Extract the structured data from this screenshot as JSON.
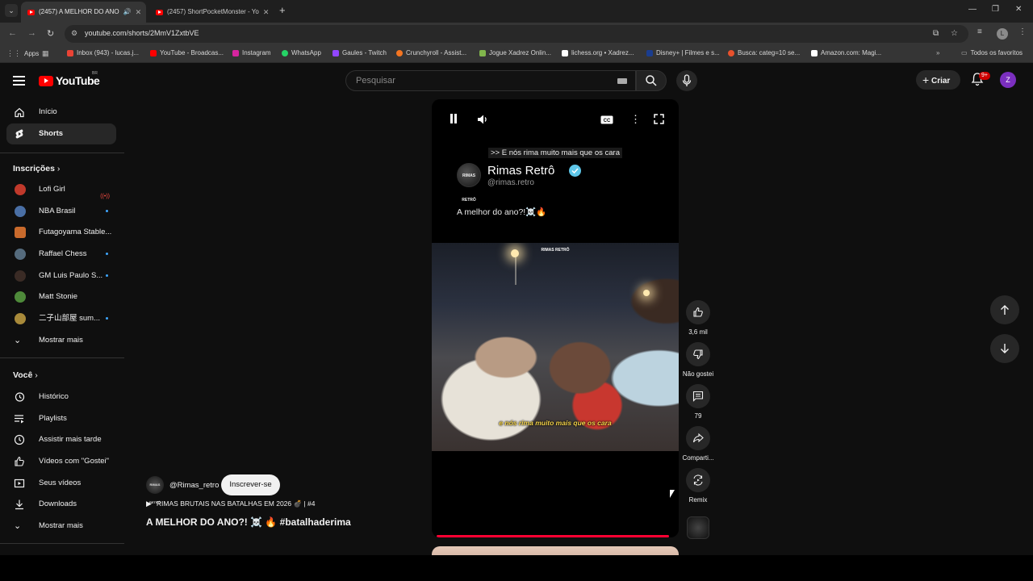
{
  "browser": {
    "tabs": [
      {
        "title": "(2457) A MELHOR DO ANO",
        "active": true
      },
      {
        "title": "(2457) ShortPocketMonster - Yo",
        "active": false
      }
    ],
    "url": "youtube.com/shorts/2MmV1ZxtbVE",
    "profile_initial": "L",
    "bookmarks": [
      {
        "label": "Apps",
        "color": "#8ab4f8"
      },
      {
        "label": "Inbox (943) - lucas.j...",
        "color": "#ea4335"
      },
      {
        "label": "YouTube - Broadcas...",
        "color": "#ff0000"
      },
      {
        "label": "Instagram",
        "color": "#d6249f"
      },
      {
        "label": "WhatsApp",
        "color": "#25d366"
      },
      {
        "label": "Gaules - Twitch",
        "color": "#9146ff"
      },
      {
        "label": "Crunchyroll - Assist...",
        "color": "#f47521"
      },
      {
        "label": "Jogue Xadrez Onlin...",
        "color": "#81b64c"
      },
      {
        "label": "lichess.org • Xadrez...",
        "color": "#ffffff"
      },
      {
        "label": "Disney+ | Filmes e s...",
        "color": "#1a3d8f"
      },
      {
        "label": "Busca: categ=10 se...",
        "color": "#e8512c"
      },
      {
        "label": "Amazon.com: Magi...",
        "color": "#ffffff"
      }
    ],
    "all_bookmarks": "Todos os favoritos"
  },
  "header": {
    "logo_text": "YouTube",
    "country_code": "BR",
    "search_placeholder": "Pesquisar",
    "create_label": "Criar",
    "notif_badge": "9+",
    "avatar_initial": "Z"
  },
  "sidebar": {
    "main": [
      {
        "label": "Início"
      },
      {
        "label": "Shorts"
      }
    ],
    "subs_title": "Inscrições",
    "subs": [
      {
        "label": "Lofi Girl",
        "color": "#c0392b"
      },
      {
        "label": "NBA Brasil",
        "color": "#4a6fa5"
      },
      {
        "label": "Futagoyama Stable...",
        "color": "#c96a2c"
      },
      {
        "label": "Raffael Chess",
        "color": "#556b7d"
      },
      {
        "label": "GM Luis Paulo S...",
        "color": "#3a2b25"
      },
      {
        "label": "Matt Stonie",
        "color": "#4e8a3a"
      },
      {
        "label": "二子山部屋 sum...",
        "color": "#a88a3a"
      }
    ],
    "show_more": "Mostrar mais",
    "you_title": "Você",
    "you": [
      {
        "label": "Histórico"
      },
      {
        "label": "Playlists"
      },
      {
        "label": "Assistir mais tarde"
      },
      {
        "label": "Vídeos com \"Gostei\""
      },
      {
        "label": "Seus vídeos"
      },
      {
        "label": "Downloads"
      }
    ],
    "show_more_2": "Mostrar mais"
  },
  "video": {
    "caption_top": ">> E nós rima muito mais que os cara",
    "post_name": "Rimas Retrô",
    "post_handle": "@rimas.retro",
    "post_text": "A melhor do ano?!☠️🔥",
    "watermark": "RIMAS RETRÔ",
    "subtitle": "e nós rima muito mais que os cara",
    "progress": 0.98
  },
  "actions": {
    "likes": "3,6 mil",
    "dislike": "Não gostei",
    "comments": "79",
    "share": "Comparti...",
    "remix": "Remix"
  },
  "meta": {
    "avatar_text": "RIMAS RETRÔ",
    "handle": "@Rimas_retro",
    "subscribe": "Inscrever-se",
    "playlist": "RIMAS BRUTAIS NAS BATALHAS EM 2026 💣 | #4",
    "title": "A MELHOR DO ANO?! ☠️ 🔥 #batalhaderima"
  }
}
